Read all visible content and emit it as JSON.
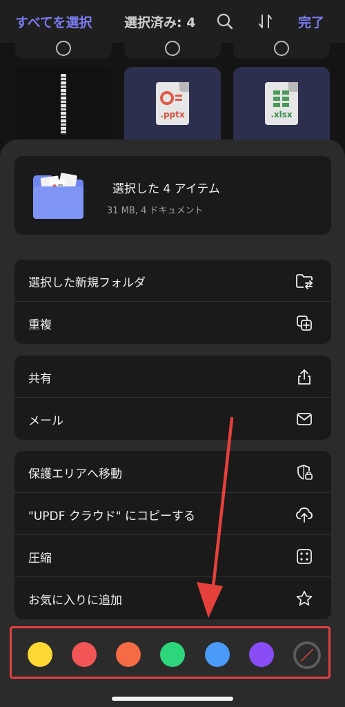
{
  "topbar": {
    "select_all": "すべてを選択",
    "selected_count": "選択済み: 4",
    "done": "完了"
  },
  "grid": {
    "ppt_ext": ".pptx",
    "xlsx_ext": ".xlsx"
  },
  "summary": {
    "title": "選択した 4 アイテム",
    "subtitle": "31 MB, 4 ドキュメント"
  },
  "menu": {
    "group1": [
      {
        "label": "選択した新規フォルダ",
        "icon": "folder-move-icon"
      },
      {
        "label": "重複",
        "icon": "duplicate-icon"
      }
    ],
    "group2": [
      {
        "label": "共有",
        "icon": "share-icon"
      },
      {
        "label": "メール",
        "icon": "mail-icon"
      }
    ],
    "group3": [
      {
        "label": "保護エリアへ移動",
        "icon": "shield-lock-icon"
      },
      {
        "label": "\"UPDF クラウド\" にコピーする",
        "icon": "cloud-upload-icon"
      },
      {
        "label": "圧縮",
        "icon": "compress-icon"
      },
      {
        "label": "お気に入りに追加",
        "icon": "star-icon"
      }
    ]
  },
  "colors": {
    "tags": [
      "#fdd835",
      "#f25555",
      "#f46b45",
      "#2ed67b",
      "#4a9bf8",
      "#8a4cf5"
    ],
    "accent": "#7a7cf2",
    "highlight": "#e24040"
  }
}
